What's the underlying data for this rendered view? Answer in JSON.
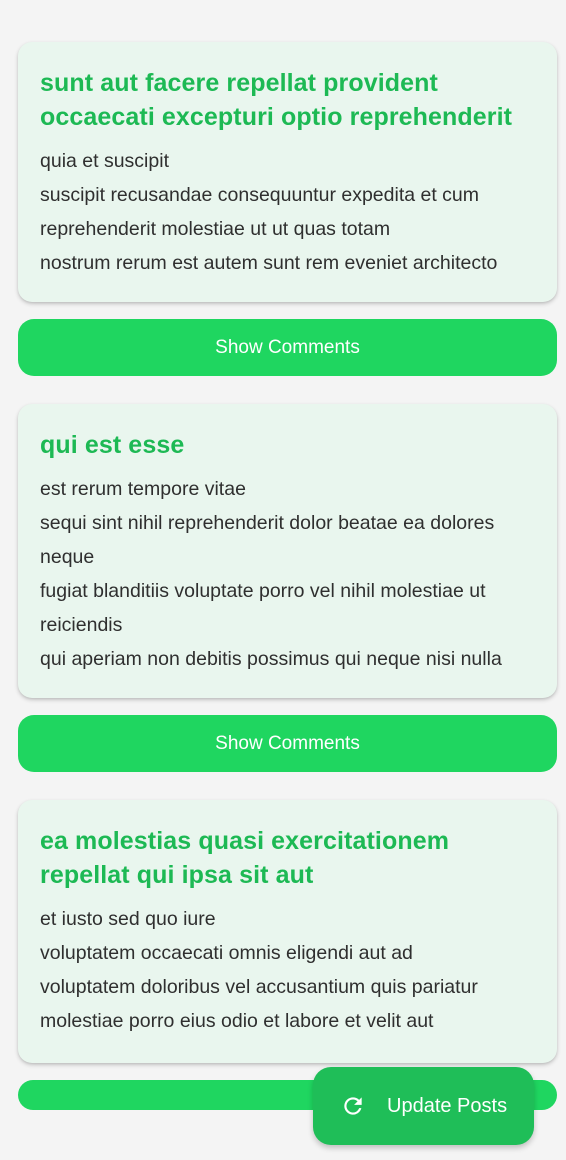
{
  "posts": [
    {
      "title": "sunt aut facere repellat provident occaecati excepturi optio reprehenderit",
      "body": "quia et suscipit\nsuscipit recusandae consequuntur expedita et cum reprehenderit molestiae ut ut quas totam\nnostrum rerum est autem sunt rem eveniet architecto"
    },
    {
      "title": "qui est esse",
      "body": "est rerum tempore vitae\nsequi sint nihil reprehenderit dolor beatae ea dolores neque\nfugiat blanditiis voluptate porro vel nihil molestiae ut reiciendis\nqui aperiam non debitis possimus qui neque nisi nulla"
    },
    {
      "title": "ea molestias quasi exercitationem repellat qui ipsa sit aut",
      "body": "et iusto sed quo iure\nvoluptatem occaecati omnis eligendi aut ad\nvoluptatem doloribus vel accusantium quis pariatur\nmolestiae porro eius odio et labore et velit aut"
    }
  ],
  "comments_button_label": "Show Comments",
  "fab": {
    "label": "Update Posts",
    "icon": "refresh-icon"
  },
  "colors": {
    "title_green": "#1db954",
    "button_green": "#1fd660",
    "fab_green": "#1fbe58",
    "card_background": "#e9f6ee"
  }
}
